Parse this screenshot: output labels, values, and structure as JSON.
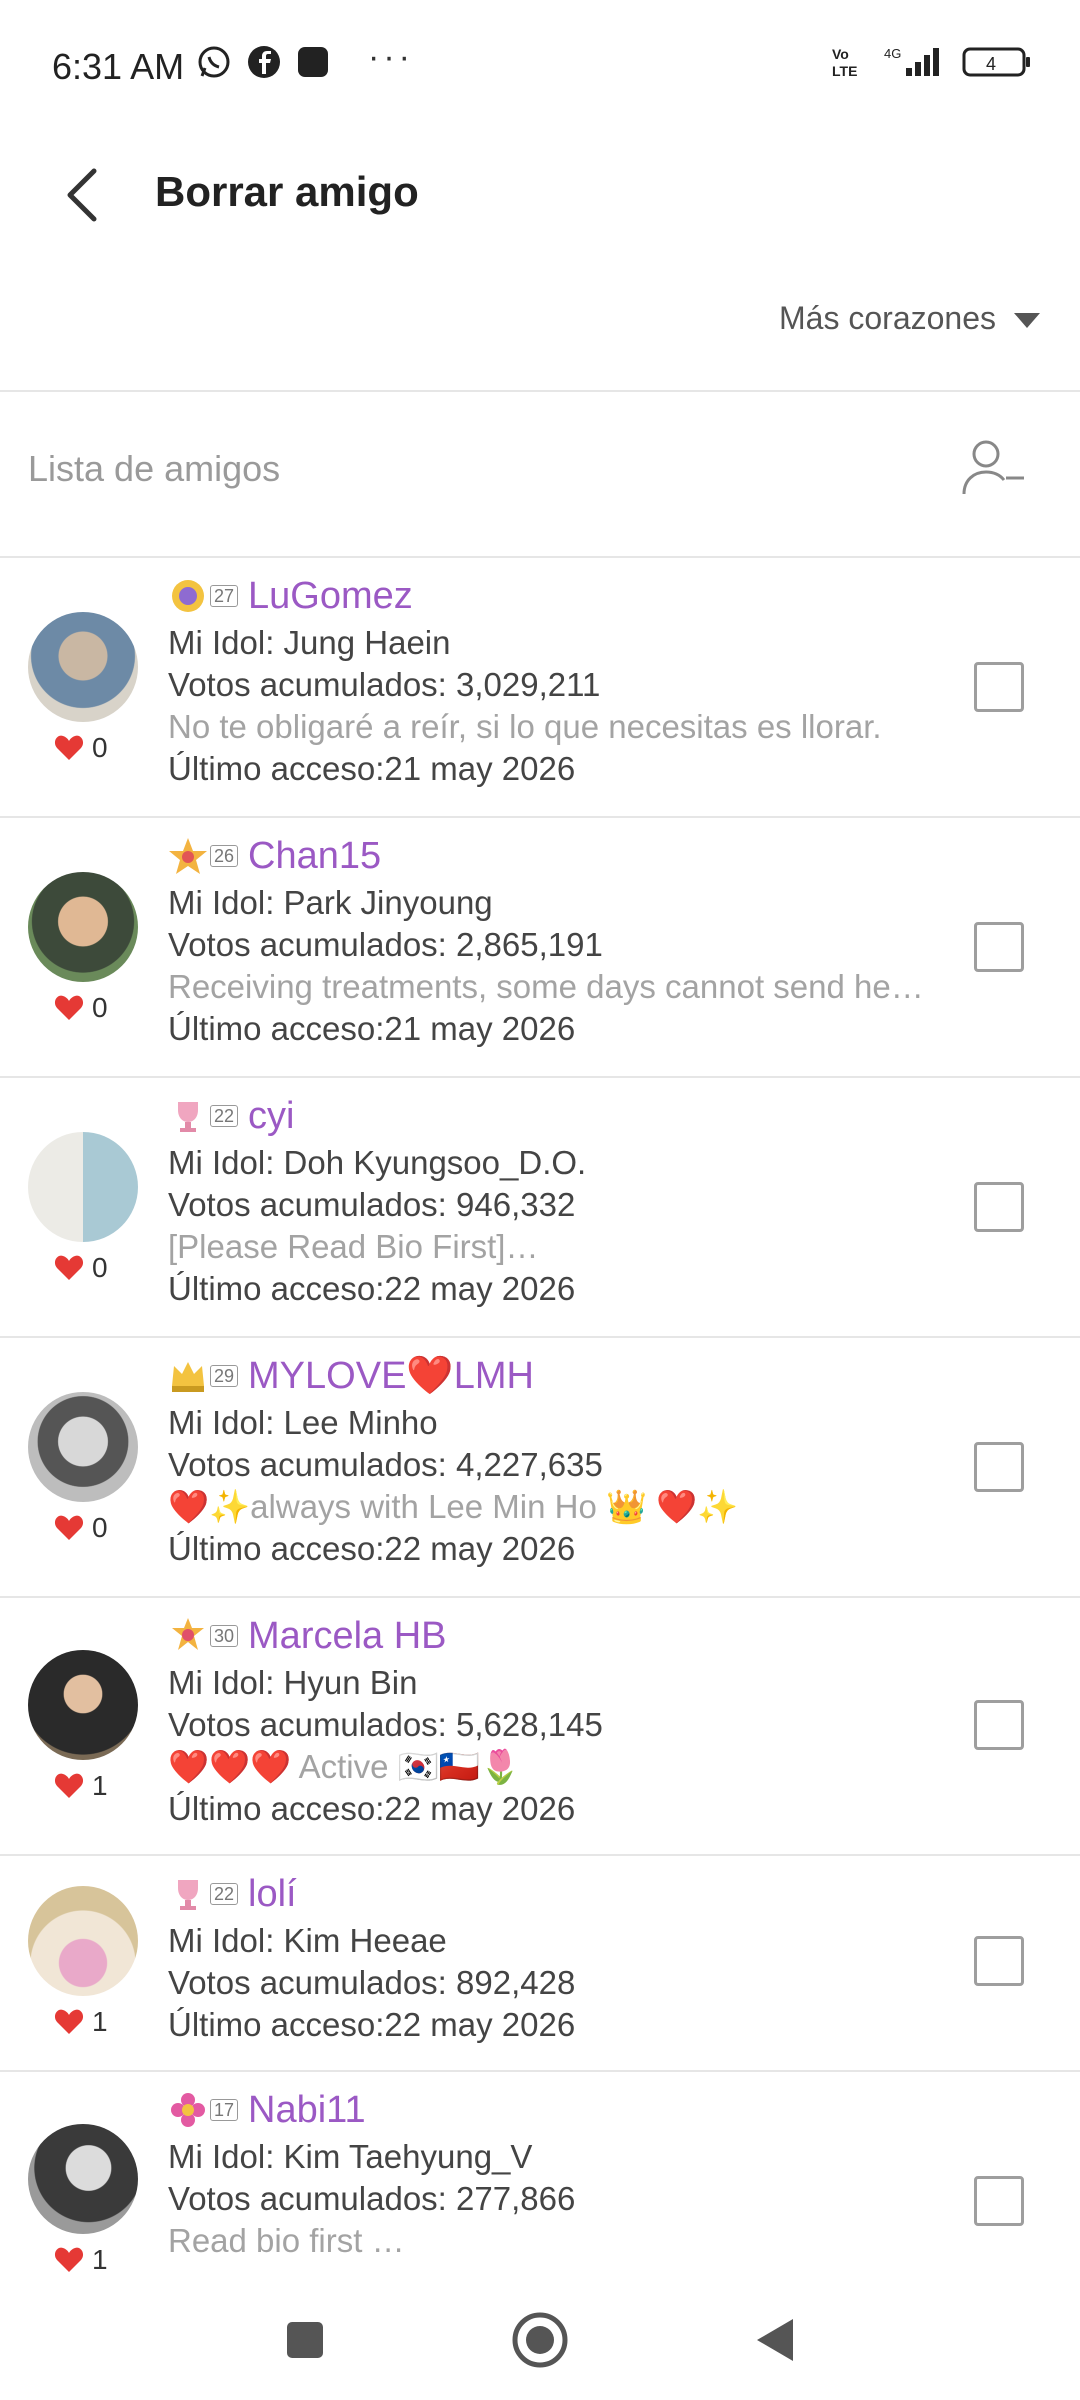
{
  "status": {
    "time": "6:31 AM",
    "network": "4G",
    "volte": "Vo LTE",
    "battery": "4"
  },
  "header": {
    "title": "Borrar amigo"
  },
  "sort": {
    "label": "Más corazones"
  },
  "list_header": {
    "label": "Lista de amigos"
  },
  "friends": [
    {
      "name": "LuGomez",
      "level": "27",
      "idol": "Mi Idol: Jung Haein",
      "votes": "Votos acumulados: 3,029,211",
      "bio": "No te obligaré a reír, si lo que necesitas es llorar.",
      "last_access": "Último acceso:21 may 2026",
      "hearts": "0"
    },
    {
      "name": "Chan15",
      "level": "26",
      "idol": "Mi Idol: Park Jinyoung",
      "votes": "Votos acumulados: 2,865,191",
      "bio": "Receiving treatments, some days cannot send he…",
      "last_access": "Último acceso:21 may 2026",
      "hearts": "0"
    },
    {
      "name": "cyi",
      "level": "22",
      "idol": "Mi Idol: Doh Kyungsoo_D.O.",
      "votes": "Votos acumulados: 946,332",
      "bio": "[Please Read Bio First]…",
      "last_access": "Último acceso:22 may 2026",
      "hearts": "0"
    },
    {
      "name": "MYLOVE❤️LMH",
      "level": "29",
      "idol": "Mi Idol: Lee Minho",
      "votes": "Votos acumulados: 4,227,635",
      "bio": "❤️✨always with Lee Min Ho 👑 ❤️✨",
      "last_access": "Último acceso:22 may 2026",
      "hearts": "0"
    },
    {
      "name": "Marcela HB",
      "level": "30",
      "idol": "Mi Idol: Hyun Bin",
      "votes": "Votos acumulados: 5,628,145",
      "bio": "❤️❤️❤️ Active 🇰🇷🇨🇱🌷",
      "last_access": "Último acceso:22 may 2026",
      "hearts": "1"
    },
    {
      "name": "lolí",
      "level": "22",
      "idol": "Mi Idol: Kim Heeae",
      "votes": "Votos acumulados: 892,428",
      "bio": "",
      "last_access": "Último acceso:22 may 2026",
      "hearts": "1"
    },
    {
      "name": "Nabi11",
      "level": "17",
      "idol": "Mi Idol: Kim Taehyung_V",
      "votes": "Votos acumulados: 277,866",
      "bio": "Read bio first …",
      "last_access": "",
      "hearts": "1"
    }
  ],
  "colors": {
    "accent_name": "#9b59c4",
    "heart": "#e53935",
    "divider": "#e6e6e6"
  }
}
